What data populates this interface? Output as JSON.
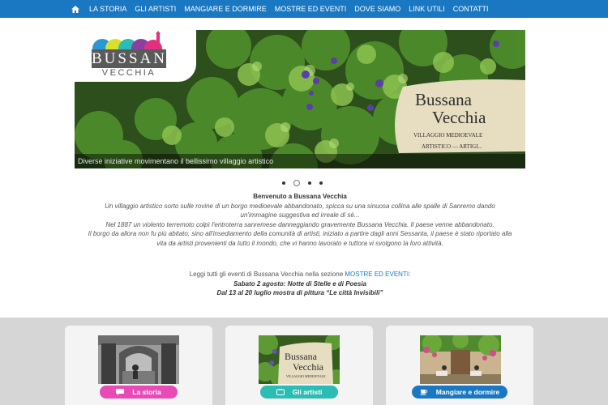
{
  "nav": {
    "home_icon": "home-icon",
    "items": [
      "LA STORIA",
      "GLI ARTISTI",
      "MANGIARE E DORMIRE",
      "MOSTRE ED EVENTI",
      "DOVE SIAMO",
      "LINK UTILI",
      "CONTATTI"
    ]
  },
  "logo": {
    "title": "BUSSANA",
    "subtitle": "VECCHIA"
  },
  "hero": {
    "caption": "Diverse iniziative movimentano il bellissimo villaggio artistico",
    "sign_line1": "Bussana",
    "sign_line2": "Vecchia",
    "sign_line3": "VILLAGGIO MEDIOEVALE",
    "sign_line4": "ARTISTICO — ARTIGI..."
  },
  "slider": {
    "count": 4,
    "active_index": 1
  },
  "intro": {
    "title": "Benvenuto a Bussana Vecchia",
    "line1": "Un villaggio artistico sorto sulle rovine di un borgo medioevale abbandonato, spicca su una sinuosa collina alle spalle di Sanremo dando",
    "line2": "un'immagine suggestiva ed irreale di sè...",
    "line3": "Nel 1887 un violento terremoto colpì l'entroterra sanremese danneggiando gravemente Bussana Vecchia. Il paese venne abbandonato.",
    "line4": "Il borgo da allora non fu più abitato, sino all'insediamento della comunità di artisti, iniziato a partire dagli anni Sessanta, il paese è stato riportato alla",
    "line5": "vita da artisti provenienti da tutto il mondo, che vi hanno lavorato e tuttora vi svolgono la loro attività."
  },
  "events": {
    "lead": "Leggi tutti gli eventi di Bussana Vecchia nella sezione ",
    "link": "MOSTRE ED EVENTI",
    "lead_end": ":",
    "event1": "Sabato 2 agosto: Notte di Stelle e di Poesia",
    "event2": "Dal 13 al 20 luglio mostra di pittura “Le città Invisibili”"
  },
  "cards": [
    {
      "label": "La storia",
      "icon": "chat-bubble-icon",
      "color": "#e94bb6"
    },
    {
      "label": "Gli artisti",
      "icon": "tv-icon",
      "color": "#2bbcb3"
    },
    {
      "label": "Mangiare e dormire",
      "icon": "coffee-cup-icon",
      "color": "#1a78c2"
    }
  ]
}
